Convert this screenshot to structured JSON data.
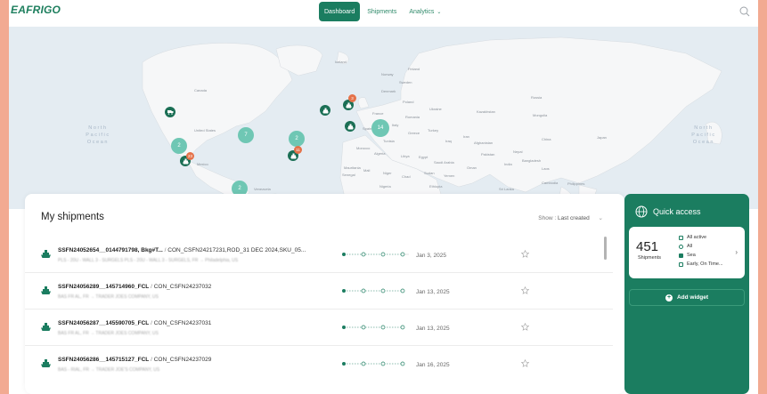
{
  "header": {
    "logo": "EAFRIGO",
    "tagline": "",
    "nav": [
      {
        "label": "Dashboard",
        "active": true
      },
      {
        "label": "Shipments",
        "active": false
      },
      {
        "label": "Analytics",
        "active": false
      }
    ],
    "search_icon": "search-icon"
  },
  "map": {
    "countries": [
      "Canada",
      "United States",
      "Mexico",
      "Venezuela",
      "Iceland",
      "Norway",
      "Finland",
      "Sweden",
      "Denmark",
      "Poland",
      "Ukraine",
      "France",
      "Romania",
      "Spain",
      "Italy",
      "Greece",
      "Turkey",
      "Russia",
      "Kazakhstan",
      "Mongolia",
      "China",
      "Japan",
      "Iran",
      "Iraq",
      "Afghanistan",
      "Pakistan",
      "Nepal",
      "India",
      "Bangladesh",
      "Laos",
      "Cambodia",
      "Philippines",
      "Morocco",
      "Tunisia",
      "Algeria",
      "Libya",
      "Egypt",
      "Saudi Arabia",
      "Oman",
      "Yemen",
      "Mauritania",
      "Senegal",
      "Mali",
      "Niger",
      "Chad",
      "Sudan",
      "Nigeria",
      "Ethiopia",
      "Sri Lanka"
    ],
    "oceans": [
      "North Pacific Ocean",
      "North Pacific Ocean"
    ],
    "clusters": [
      "2",
      "7",
      "2",
      "2",
      "2",
      "14"
    ],
    "badges": [
      "23",
      "3",
      "11"
    ]
  },
  "shipments": {
    "title": "My shipments",
    "show_label": "Show :",
    "show_value": "Last created",
    "rows": [
      {
        "id": "SSFN24052654__0144791798, Bkg#T...",
        "container": "CON_CSFN24217231,ROD_31 DEC 2024,SKU_05...",
        "route": "PLS - 20U - WALL 3 - SURGELS PLS - 20U - WALL 3 - SURGELS, FR → Philadelphia, US",
        "date": "Jan 3, 2025",
        "progress": 0.66
      },
      {
        "id": "SSFN24056289__145714960_FCL",
        "container": "CON_CSFN24237032",
        "route": "BAS FR AL, FR → TRADER JOES COMPANY, US",
        "date": "Jan 13, 2025",
        "progress": 0.0
      },
      {
        "id": "SSFN24056287__145590705_FCL",
        "container": "CON_CSFN24237031",
        "route": "BAS FR AL, FR → TRADER JOES COMPANY, US",
        "date": "Jan 13, 2025",
        "progress": 0.0
      },
      {
        "id": "SSFN24056286__145715127_FCL",
        "container": "CON_CSFN24237029",
        "route": "BAS - RIAL, FR → TRADER JOE'S COMPANY, US",
        "date": "Jan 16, 2025",
        "progress": 0.0
      }
    ]
  },
  "quick_access": {
    "title": "Quick access",
    "count": "451",
    "count_label": "Shipments",
    "filters": [
      "All active",
      "All",
      "Sea",
      "Early, On Time..."
    ],
    "add_widget": "Add widget"
  },
  "colors": {
    "brand": "#1b7d60",
    "cluster": "#6fc7b4",
    "badge": "#e5724a",
    "page_bg": "#f2aa92"
  }
}
